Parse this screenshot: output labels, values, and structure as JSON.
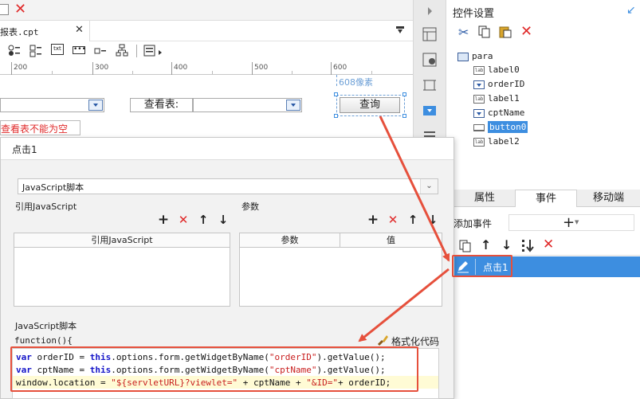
{
  "designer": {
    "file_tab": "报表.cpt",
    "ruler_ticks": [
      "200",
      "300",
      "400",
      "600"
    ],
    "width_hint": "608像素",
    "canvas": {
      "lookup_label": "查看表:",
      "query_button": "查询",
      "error_text": "查看表不能为空"
    }
  },
  "icons": {
    "toolbar": [
      "new-file-icon",
      "close-red-icon"
    ],
    "widget_bar": [
      "radio-group-icon",
      "checkbox-group-icon",
      "text-widget-icon",
      "password-icon",
      "button-widget-icon",
      "tree-widget-icon",
      "more-widgets-icon"
    ],
    "strip": [
      "collapse-arrow-icon",
      "layout-icon",
      "widget-icon",
      "frame-icon",
      "dropdown-icon",
      "list-icon"
    ]
  },
  "right_panel": {
    "title": "控件设置",
    "tree_root": "para",
    "tree_items": [
      {
        "name": "label0",
        "kind": "label"
      },
      {
        "name": "orderID",
        "kind": "dropdown"
      },
      {
        "name": "label1",
        "kind": "label"
      },
      {
        "name": "cptName",
        "kind": "dropdown"
      },
      {
        "name": "button0",
        "kind": "button"
      },
      {
        "name": "label2",
        "kind": "label"
      }
    ],
    "tree_selected": "button0",
    "prop_tabs": [
      "属性",
      "事件",
      "移动端"
    ],
    "prop_tab_active": "事件",
    "add_event_label": "添加事件",
    "event_item": "点击1"
  },
  "dialog": {
    "title": "点击1",
    "script_type": "JavaScript脚本",
    "ref_js_label": "引用JavaScript",
    "params_label": "参数",
    "ref_js_col": "引用JavaScript",
    "params_cols": [
      "参数",
      "值"
    ],
    "script_label": "JavaScript脚本",
    "format_button": "格式化代码",
    "function_header": "function(){",
    "code_lines": [
      "var orderID = this.options.form.getWidgetByName(\"orderID\").getValue();",
      "var cptName = this.options.form.getWidgetByName(\"cptName\").getValue();",
      "window.location = \"${servletURL}?viewlet=\" + cptName + \"&ID=\"+ orderID;"
    ]
  },
  "colors": {
    "accent_blue": "#3d8ee0",
    "annotation_red": "#e6503c",
    "selected_row": "#3d8ee0",
    "current_line": "#fffbd5"
  }
}
